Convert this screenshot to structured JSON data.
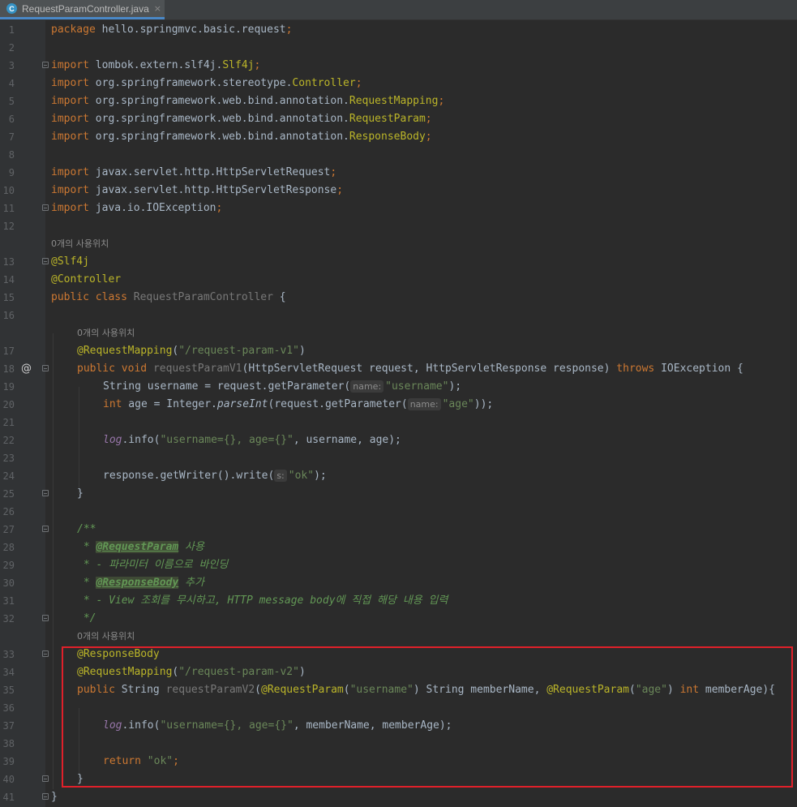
{
  "tab": {
    "title": "RequestParamController.java",
    "icon": "C",
    "close": "×"
  },
  "hints": {
    "class_usages": "0개의 사용위치",
    "v1_usages": "0개의 사용위치",
    "v2_usages": "0개의 사용위치"
  },
  "lines": {
    "l1": {
      "n": "1"
    },
    "l2": {
      "n": "2"
    },
    "l3": {
      "n": "3"
    },
    "l4": {
      "n": "4"
    },
    "l5": {
      "n": "5"
    },
    "l6": {
      "n": "6"
    },
    "l7": {
      "n": "7"
    },
    "l8": {
      "n": "8"
    },
    "l9": {
      "n": "9"
    },
    "l10": {
      "n": "10"
    },
    "l11": {
      "n": "11"
    },
    "l12": {
      "n": "12"
    },
    "l13": {
      "n": "13"
    },
    "l14": {
      "n": "14"
    },
    "l15": {
      "n": "15"
    },
    "l16": {
      "n": "16"
    },
    "l17": {
      "n": "17"
    },
    "l18": {
      "n": "18"
    },
    "l19": {
      "n": "19"
    },
    "l20": {
      "n": "20"
    },
    "l21": {
      "n": "21"
    },
    "l22": {
      "n": "22"
    },
    "l23": {
      "n": "23"
    },
    "l24": {
      "n": "24"
    },
    "l25": {
      "n": "25"
    },
    "l26": {
      "n": "26"
    },
    "l27": {
      "n": "27"
    },
    "l28": {
      "n": "28"
    },
    "l29": {
      "n": "29"
    },
    "l30": {
      "n": "30"
    },
    "l31": {
      "n": "31"
    },
    "l32": {
      "n": "32"
    },
    "l33": {
      "n": "33"
    },
    "l34": {
      "n": "34"
    },
    "l35": {
      "n": "35"
    },
    "l36": {
      "n": "36"
    },
    "l37": {
      "n": "37"
    },
    "l38": {
      "n": "38"
    },
    "l39": {
      "n": "39"
    },
    "l40": {
      "n": "40"
    },
    "l41": {
      "n": "41"
    }
  },
  "code": {
    "package_kw": "package",
    "package_name": " hello.springmvc.basic.request",
    "import_kw": "import",
    "imp_lombok": " lombok.extern.slf4j.",
    "imp_lombok_cls": "Slf4j",
    "imp_stereo": " org.springframework.stereotype.",
    "imp_stereo_cls": "Controller",
    "imp_bind": " org.springframework.web.bind.annotation.",
    "imp_reqmap": "RequestMapping",
    "imp_reqparam": "RequestParam",
    "imp_respbody": "ResponseBody",
    "imp_servreq": " javax.servlet.http.HttpServletRequest",
    "imp_servresp": " javax.servlet.http.HttpServletResponse",
    "imp_ioex": " java.io.IOException",
    "semi": ";",
    "ann_slf4j": "@Slf4j",
    "ann_controller": "@Controller",
    "public_kw": "public",
    "class_kw": "class",
    "class_name": "RequestParamController",
    "open_brace": "{",
    "close_brace": "}",
    "ann_reqmap": "@RequestMapping",
    "ann_respbody": "@ResponseBody",
    "ann_reqparam": "@RequestParam",
    "path_v1": "\"/request-param-v1\"",
    "path_v2": "\"/request-param-v2\"",
    "void_kw": "void",
    "method_v1": "requestParamV1",
    "method_v2": "requestParamV2",
    "v1_params": "(HttpServletRequest request, HttpServletResponse response) ",
    "throws_kw": "throws",
    "v1_throws_rest": " IOException {",
    "string_type": "String",
    "l19_a": "String username = request.getParameter(",
    "hint_name": "name:",
    "str_username": "\"username\"",
    "close_paren_semi": ");",
    "int_kw": "int",
    "l20_a": " age = Integer.",
    "parse_int": "parseInt",
    "l20_b": "(request.getParameter(",
    "str_age": "\"age\"",
    "close_2paren_semi": "));",
    "log": "log",
    "info_call": ".info(",
    "log_fmt": "\"username={}, age={}\"",
    "log_args_v1": ", username, age);",
    "l24_a": "response.getWriter().write(",
    "hint_s": "s:",
    "str_ok": "\"ok\"",
    "doc_open": "/**",
    "doc_star": " * ",
    "doc_l28_rest": " 사용",
    "doc_l29": " * - 파라미터 이름으로 바인딩",
    "doc_l30_rest": " 추가",
    "doc_l31": " * - View 조회를 무시하고, HTTP message body에 직접 해당 내용 입력",
    "doc_close": " */",
    "doc_tag_reqparam": "@RequestParam",
    "doc_tag_respbody": "@ResponseBody",
    "v2_sig_a": "(",
    "v2_sig_str_user": "\"username\"",
    "v2_sig_b": " String memberName, ",
    "v2_sig_str_age": "\"age\"",
    "v2_sig_c": ") ",
    "v2_sig_d": " memberAge){",
    "paren_open": "(",
    "paren_close": ")",
    "log_args_v2": ", memberName, memberAge);",
    "return_kw": "return",
    "ok_semi": ";"
  },
  "colors": {
    "background": "#2b2b2b",
    "keyword": "#cc7832",
    "annotation": "#bbb529",
    "string": "#6a8759",
    "comment": "#629755",
    "highlight_box": "#e0202a"
  }
}
